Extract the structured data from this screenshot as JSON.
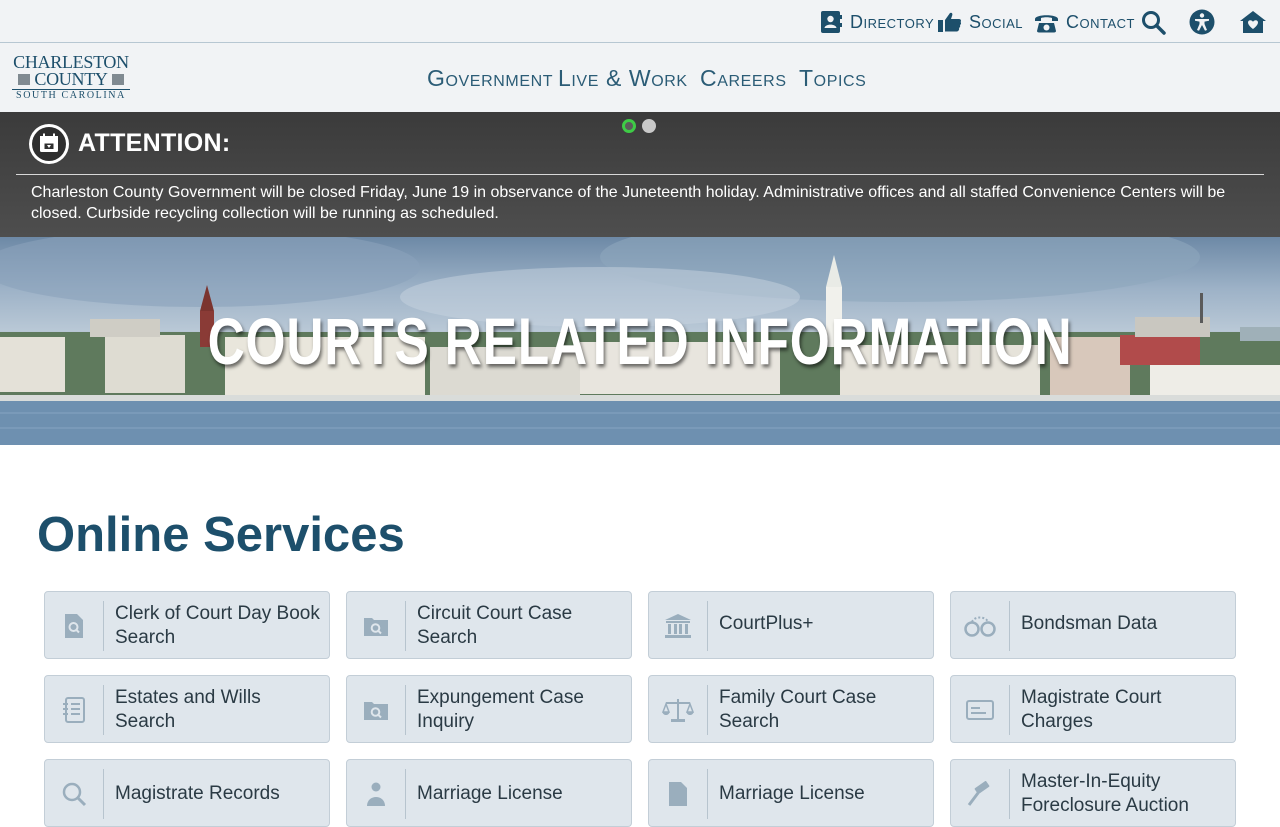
{
  "utility": {
    "directory": "Directory",
    "social": "Social",
    "contact": "Contact"
  },
  "logo": {
    "line1": "CHARLESTON",
    "line2": "COUNTY",
    "line3": "SOUTH CAROLINA"
  },
  "nav": {
    "government": "Government",
    "live_work": "Live & Work",
    "careers": "Careers",
    "topics": "Topics"
  },
  "attention": {
    "title": "ATTENTION:",
    "message": "Charleston County Government will be closed Friday, June 19 in observance of the Juneteenth holiday. Administrative offices and all staffed Convenience Centers will be closed. Curbside recycling collection will be running as scheduled."
  },
  "hero": {
    "title": "COURTS RELATED INFORMATION"
  },
  "services": {
    "title": "Online Services",
    "tiles": [
      {
        "label": "Clerk of Court Day Book Search",
        "icon": "document-search-icon"
      },
      {
        "label": "Circuit Court Case Search",
        "icon": "folder-search-icon"
      },
      {
        "label": "CourtPlus+",
        "icon": "courthouse-icon"
      },
      {
        "label": "Bondsman Data",
        "icon": "handcuffs-icon"
      },
      {
        "label": "Estates and Wills Search",
        "icon": "notebook-icon"
      },
      {
        "label": "Expungement Case Inquiry",
        "icon": "folder-search-icon"
      },
      {
        "label": "Family Court Case Search",
        "icon": "scales-icon"
      },
      {
        "label": "Magistrate Court Charges",
        "icon": "card-icon"
      },
      {
        "label": "Magistrate Records",
        "icon": "search-icon"
      },
      {
        "label": "Marriage License",
        "icon": "person-icon"
      },
      {
        "label": "Marriage License",
        "icon": "document-icon"
      },
      {
        "label": "Master-In-Equity Foreclosure Auction",
        "icon": "gavel-icon"
      }
    ]
  },
  "colors": {
    "brand": "#1d4f6b",
    "tile_bg": "#dfe6ec",
    "banner_bg": "#474747",
    "active_dot": "#3ecb46"
  }
}
